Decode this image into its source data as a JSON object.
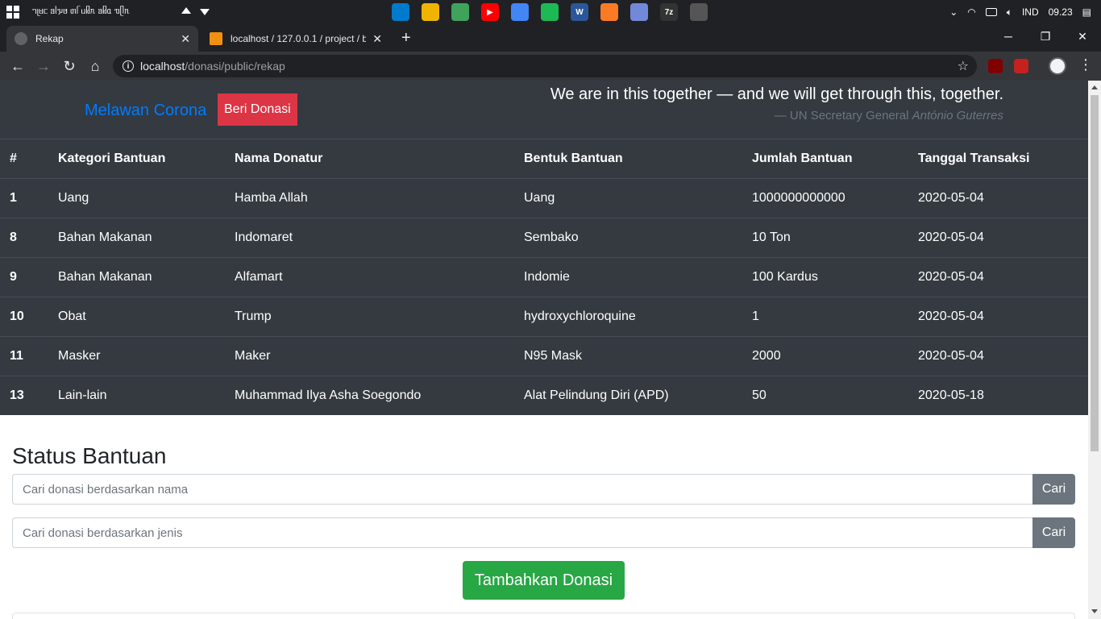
{
  "taskbar": {
    "ime_text": "ᥐᥨᥛᥴ ᥑᥣᥭᥳ ᥖᥬ ᥙᥤᥰ ᥑᥤᥲ ᥓᥫᥰ",
    "language": "IND",
    "time": "09.23",
    "apps": [
      {
        "icon": "vscode-icon",
        "color": "#007acc",
        "label": ""
      },
      {
        "icon": "file-explorer-icon",
        "color": "#f0b400",
        "label": ""
      },
      {
        "icon": "chrome-green-icon",
        "color": "#3fa35b",
        "label": ""
      },
      {
        "icon": "youtube-icon",
        "color": "#ff0000",
        "label": "▶"
      },
      {
        "icon": "chrome-icon",
        "color": "#4285f4",
        "label": ""
      },
      {
        "icon": "spotify-icon",
        "color": "#1db954",
        "label": ""
      },
      {
        "icon": "word-icon",
        "color": "#2b579a",
        "label": "W"
      },
      {
        "icon": "xampp-icon",
        "color": "#fb7a24",
        "label": ""
      },
      {
        "icon": "discord-icon",
        "color": "#7289da",
        "label": ""
      },
      {
        "icon": "7zip-icon",
        "color": "#333333",
        "label": "7z"
      },
      {
        "icon": "shield-app-icon",
        "color": "#555555",
        "label": ""
      }
    ]
  },
  "browser": {
    "tabs": [
      {
        "title": "Rekap",
        "active": true
      },
      {
        "title": "localhost / 127.0.0.1 / project / b",
        "active": false
      }
    ],
    "url_host": "localhost",
    "url_path": "/donasi/public/rekap"
  },
  "header": {
    "brand": "Melawan Corona",
    "donate_button": "Beri Donasi",
    "quote": "We are in this together — and we will get through this, together.",
    "quote_cite_prefix": "— UN Secretary General ",
    "quote_cite_name": "António Guterres"
  },
  "table": {
    "headers": [
      "#",
      "Kategori Bantuan",
      "Nama Donatur",
      "Bentuk Bantuan",
      "Jumlah Bantuan",
      "Tanggal Transaksi"
    ],
    "rows": [
      [
        "1",
        "Uang",
        "Hamba Allah",
        "Uang",
        "1000000000000",
        "2020-05-04"
      ],
      [
        "8",
        "Bahan Makanan",
        "Indomaret",
        "Sembako",
        "10 Ton",
        "2020-05-04"
      ],
      [
        "9",
        "Bahan Makanan",
        "Alfamart",
        "Indomie",
        "100 Kardus",
        "2020-05-04"
      ],
      [
        "10",
        "Obat",
        "Trump",
        "hydroxychloroquine",
        "1",
        "2020-05-04"
      ],
      [
        "11",
        "Masker",
        "Maker",
        "N95 Mask",
        "2000",
        "2020-05-04"
      ],
      [
        "13",
        "Lain-lain",
        "Muhammad Ilya Asha Soegondo",
        "Alat Pelindung Diri (APD)",
        "50",
        "2020-05-18"
      ]
    ]
  },
  "status": {
    "title": "Status Bantuan",
    "search_name_placeholder": "Cari donasi berdasarkan nama",
    "search_type_placeholder": "Cari donasi berdasarkan jenis",
    "search_button": "Cari",
    "add_button": "Tambahkan Donasi"
  }
}
